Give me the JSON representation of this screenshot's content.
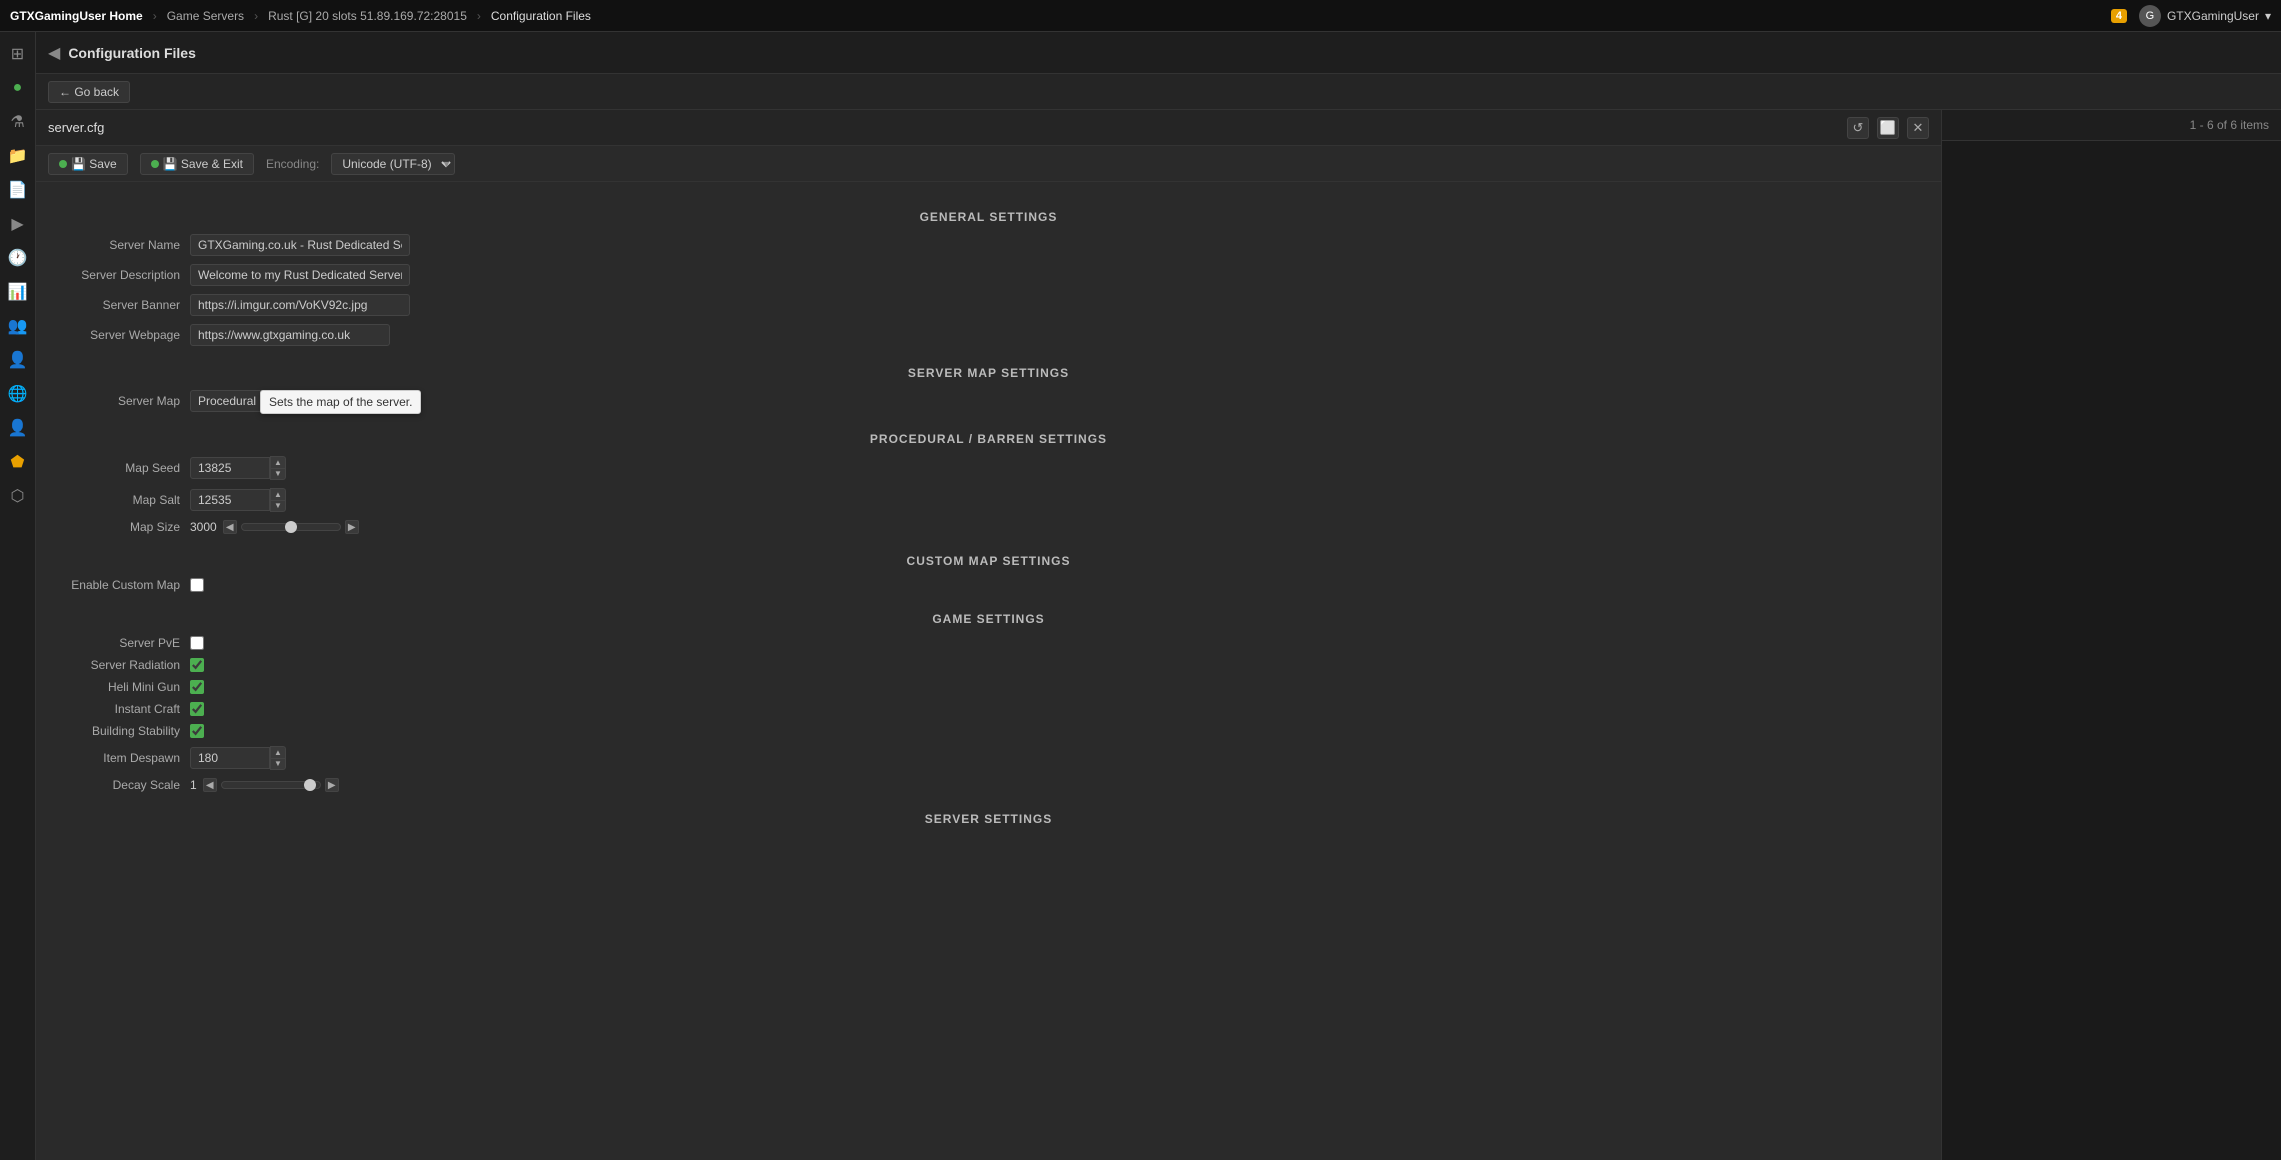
{
  "topbar": {
    "logo": "GTXGamingUser Home",
    "breadcrumbs": [
      "GTXGamingUser Home",
      "Game Servers",
      "Rust [G] 20 slots 51.89.169.72:28015",
      "Configuration Files"
    ],
    "notification_count": "4",
    "username": "GTXGamingUser",
    "dropdown_icon": "▾"
  },
  "subheader": {
    "title": "Configuration Files"
  },
  "go_back": {
    "label": "← Go back"
  },
  "editor": {
    "filename": "server.cfg",
    "save_label": "💾 Save",
    "save_exit_label": "💾 Save & Exit",
    "encoding_label": "Encoding:",
    "encoding_value": "Unicode (UTF-8)",
    "reload_icon": "↺",
    "maximize_icon": "⬜",
    "close_icon": "✕"
  },
  "right_panel": {
    "items_label": "1 - 6 of 6 items"
  },
  "general_settings": {
    "section_title": "GENERAL SETTINGS",
    "server_name_label": "Server Name",
    "server_name_value": "GTXGaming.co.uk - Rust Dedicated Server",
    "server_description_label": "Server Description",
    "server_description_value": "Welcome to my Rust Dedicated Server!\\n\\",
    "server_banner_label": "Server Banner",
    "server_banner_value": "https://i.imgur.com/VoKV92c.jpg",
    "server_webpage_label": "Server Webpage",
    "server_webpage_value": "https://www.gtxgaming.co.uk"
  },
  "server_map_settings": {
    "section_title": "SERVER MAP SETTINGS",
    "server_map_label": "Server Map",
    "server_map_value": "Procedural Map",
    "tooltip_text": "Sets the map of the server."
  },
  "procedural_settings": {
    "section_title": "PROCEDURAL / BARREN SETTINGS",
    "map_seed_label": "Map Seed",
    "map_seed_value": "13825",
    "map_salt_label": "Map Salt",
    "map_salt_value": "12535",
    "map_size_label": "Map Size",
    "map_size_value": "3000"
  },
  "custom_map_settings": {
    "section_title": "CUSTOM MAP SETTINGS",
    "enable_custom_map_label": "Enable Custom Map"
  },
  "game_settings": {
    "section_title": "GAME SETTINGS",
    "server_pve_label": "Server PvE",
    "server_radiation_label": "Server Radiation",
    "heli_mini_gun_label": "Heli Mini Gun",
    "instant_craft_label": "Instant Craft",
    "building_stability_label": "Building Stability",
    "item_despawn_label": "Item Despawn",
    "item_despawn_value": "180",
    "decay_scale_label": "Decay Scale",
    "decay_scale_value": "1"
  },
  "server_settings": {
    "section_title": "SERVER SETTINGS"
  },
  "sidebar": {
    "items": [
      {
        "icon": "⊞",
        "name": "grid-icon"
      },
      {
        "icon": "⚡",
        "name": "power-icon"
      },
      {
        "icon": "🔬",
        "name": "flask-icon"
      },
      {
        "icon": "📁",
        "name": "folder-icon"
      },
      {
        "icon": "📄",
        "name": "file-icon"
      },
      {
        "icon": "💻",
        "name": "terminal-icon"
      },
      {
        "icon": "🕐",
        "name": "clock-icon"
      },
      {
        "icon": "📊",
        "name": "chart-icon"
      },
      {
        "icon": "👥",
        "name": "users-icon"
      },
      {
        "icon": "👤",
        "name": "user-icon"
      },
      {
        "icon": "🌐",
        "name": "globe-icon"
      },
      {
        "icon": "👤",
        "name": "profile-icon"
      },
      {
        "icon": "🔴",
        "name": "red-icon"
      },
      {
        "icon": "🟠",
        "name": "orange-icon"
      }
    ]
  }
}
